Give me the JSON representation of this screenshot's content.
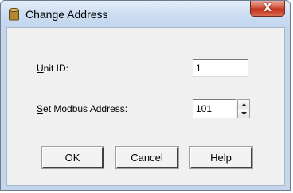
{
  "window": {
    "title": "Change Address",
    "close_label": "X"
  },
  "fields": {
    "unit_id": {
      "label_first": "U",
      "label_rest": "nit ID:",
      "value": "1"
    },
    "modbus_address": {
      "label_first": "S",
      "label_rest": "et Modbus Address:",
      "value": "101"
    }
  },
  "buttons": {
    "ok": "OK",
    "cancel": "Cancel",
    "help": "Help"
  },
  "icons": {
    "app": "database-icon",
    "close": "close-icon",
    "spin_up": "chevron-up-icon",
    "spin_down": "chevron-down-icon"
  }
}
